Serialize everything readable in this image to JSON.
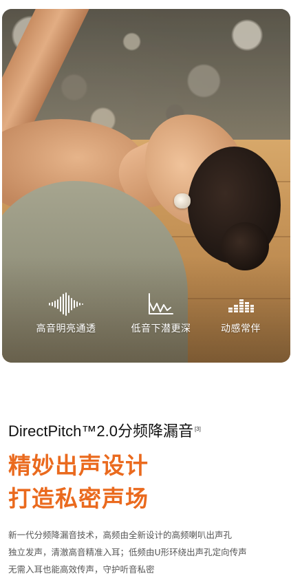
{
  "hero": {
    "image": "woman-yoga-pose-wearing-open-ear-earbud",
    "features": [
      {
        "icon": "soundwave-icon",
        "label": "高音明亮通透"
      },
      {
        "icon": "bass-wave-icon",
        "label": "低音下潜更深"
      },
      {
        "icon": "equalizer-icon",
        "label": "动感常伴"
      }
    ]
  },
  "section": {
    "title": "DirectPitch™2.0分频降漏音",
    "footnote": "[3]",
    "headline_line1": "精妙出声设计",
    "headline_line2": "打造私密声场",
    "body_lines": [
      "新一代分频降漏音技术，高频由全新设计的高频喇叭出声孔",
      "独立发声，清澈高音精准入耳；低频由U形环绕出声孔定向传声",
      "无需入耳也能高效传声，守护听音私密"
    ]
  },
  "colors": {
    "accent": "#ea6a1e",
    "title": "#111111",
    "body": "#555555"
  }
}
